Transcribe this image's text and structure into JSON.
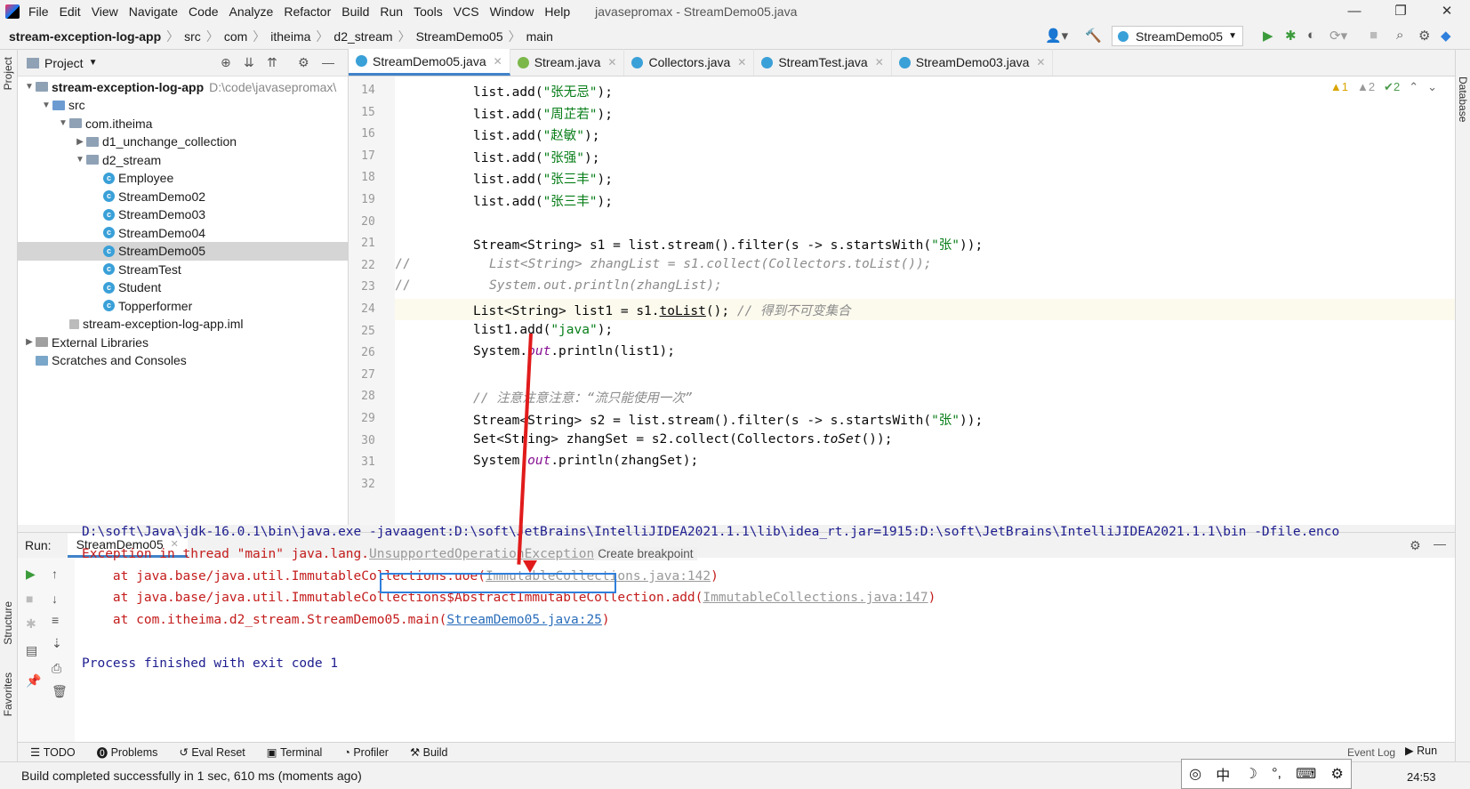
{
  "menu": {
    "items": [
      "File",
      "Edit",
      "View",
      "Navigate",
      "Code",
      "Analyze",
      "Refactor",
      "Build",
      "Run",
      "Tools",
      "VCS",
      "Window",
      "Help"
    ],
    "window_title": "javasepromax - StreamDemo05.java"
  },
  "nav": {
    "crumbs": [
      "stream-exception-log-app",
      "src",
      "com",
      "itheima",
      "d2_stream",
      "StreamDemo05",
      "main"
    ],
    "run_config": "StreamDemo05"
  },
  "project": {
    "header": "Project",
    "tree": [
      {
        "label": "stream-exception-log-app",
        "extra": "D:\\code\\javasepromax\\",
        "depth": 0,
        "arrow": "down",
        "icon": "folder",
        "bold": true
      },
      {
        "label": "src",
        "depth": 1,
        "arrow": "down",
        "icon": "folder-blue"
      },
      {
        "label": "com.itheima",
        "depth": 2,
        "arrow": "down",
        "icon": "folder"
      },
      {
        "label": "d1_unchange_collection",
        "depth": 3,
        "arrow": "right",
        "icon": "folder"
      },
      {
        "label": "d2_stream",
        "depth": 3,
        "arrow": "down",
        "icon": "folder"
      },
      {
        "label": "Employee",
        "depth": 4,
        "icon": "class"
      },
      {
        "label": "StreamDemo02",
        "depth": 4,
        "icon": "class"
      },
      {
        "label": "StreamDemo03",
        "depth": 4,
        "icon": "class"
      },
      {
        "label": "StreamDemo04",
        "depth": 4,
        "icon": "class"
      },
      {
        "label": "StreamDemo05",
        "depth": 4,
        "icon": "class",
        "selected": true
      },
      {
        "label": "StreamTest",
        "depth": 4,
        "icon": "class"
      },
      {
        "label": "Student",
        "depth": 4,
        "icon": "class"
      },
      {
        "label": "Topperformer",
        "depth": 4,
        "icon": "class"
      },
      {
        "label": "stream-exception-log-app.iml",
        "depth": 2,
        "icon": "file"
      },
      {
        "label": "External Libraries",
        "depth": 0,
        "arrow": "right",
        "icon": "lib"
      },
      {
        "label": "Scratches and Consoles",
        "depth": 0,
        "icon": "scratch"
      }
    ]
  },
  "tabs": [
    "StreamDemo05.java",
    "Stream.java",
    "Collectors.java",
    "StreamTest.java",
    "StreamDemo03.java"
  ],
  "editor": {
    "indicators": {
      "warn1": "1",
      "warn2": "2",
      "ok": "2"
    },
    "lines": [
      {
        "n": "14",
        "t": "list.add(\"张无忌\");"
      },
      {
        "n": "15",
        "t": "list.add(\"周芷若\");"
      },
      {
        "n": "16",
        "t": "list.add(\"赵敏\");"
      },
      {
        "n": "17",
        "t": "list.add(\"张强\");"
      },
      {
        "n": "18",
        "t": "list.add(\"张三丰\");"
      },
      {
        "n": "19",
        "t": "list.add(\"张三丰\");"
      },
      {
        "n": "20",
        "t": ""
      },
      {
        "n": "21",
        "t": "Stream<String> s1 = list.stream().filter(s -> s.startsWith(\"张\"));"
      },
      {
        "n": "22",
        "t": "List<String> zhangList = s1.collect(Collectors.toList());",
        "comment": true
      },
      {
        "n": "23",
        "t": "System.out.println(zhangList);",
        "comment": true
      },
      {
        "n": "24",
        "t": "List<String> list1 = s1.toList(); // 得到不可变集合"
      },
      {
        "n": "25",
        "t": "list1.add(\"java\");"
      },
      {
        "n": "26",
        "t": "System.out.println(list1);"
      },
      {
        "n": "27",
        "t": ""
      },
      {
        "n": "28",
        "t": "// 注意注意注意：“流只能使用一次”"
      },
      {
        "n": "29",
        "t": "Stream<String> s2 = list.stream().filter(s -> s.startsWith(\"张\"));"
      },
      {
        "n": "30",
        "t": "Set<String> zhangSet = s2.collect(Collectors.toSet());"
      },
      {
        "n": "31",
        "t": "System.out.println(zhangSet);"
      },
      {
        "n": "32",
        "t": ""
      }
    ]
  },
  "run": {
    "label": "Run:",
    "tab": "StreamDemo05",
    "console": {
      "cmd": "D:\\soft\\Java\\jdk-16.0.1\\bin\\java.exe -javaagent:D:\\soft\\JetBrains\\IntelliJIDEA2021.1.1\\lib\\idea_rt.jar=1915:D:\\soft\\JetBrains\\IntelliJIDEA2021.1.1\\bin -Dfile.enco",
      "exc_prefix": "Exception in thread \"main\" java.lang.",
      "exc_class": "UnsupportedOperationException",
      "create_bp": "Create breakpoint",
      "st1_pre": "    at java.base/java.util.ImmutableCollections.uoe(",
      "st1_link": "ImmutableCollections.java:142",
      "st1_post": ")",
      "st2_pre": "    at java.base/java.util.ImmutableCollections$AbstractImmutableCollection.add(",
      "st2_link": "ImmutableCollections.java:147",
      "st2_post": ")",
      "st3_pre": "    at com.itheima.d2_stream.StreamDemo05.main(",
      "st3_link": "StreamDemo05.java:25",
      "st3_post": ")",
      "finish": "Process finished with exit code 1"
    }
  },
  "bottom_tabs": [
    "TODO",
    "Problems",
    "Eval Reset",
    "Terminal",
    "Profiler",
    "Build"
  ],
  "status": {
    "text": "Build completed successfully in 1 sec, 610 ms (moments ago)",
    "run_btn": "Run",
    "clock": "24:53",
    "event_log": "Event Log"
  },
  "side": {
    "left_top": "Project",
    "left_mid": "Structure",
    "left_bot": "Favorites",
    "right": "Database"
  },
  "ime": [
    "中",
    "☽",
    "°,",
    "⌨",
    "⚙"
  ]
}
